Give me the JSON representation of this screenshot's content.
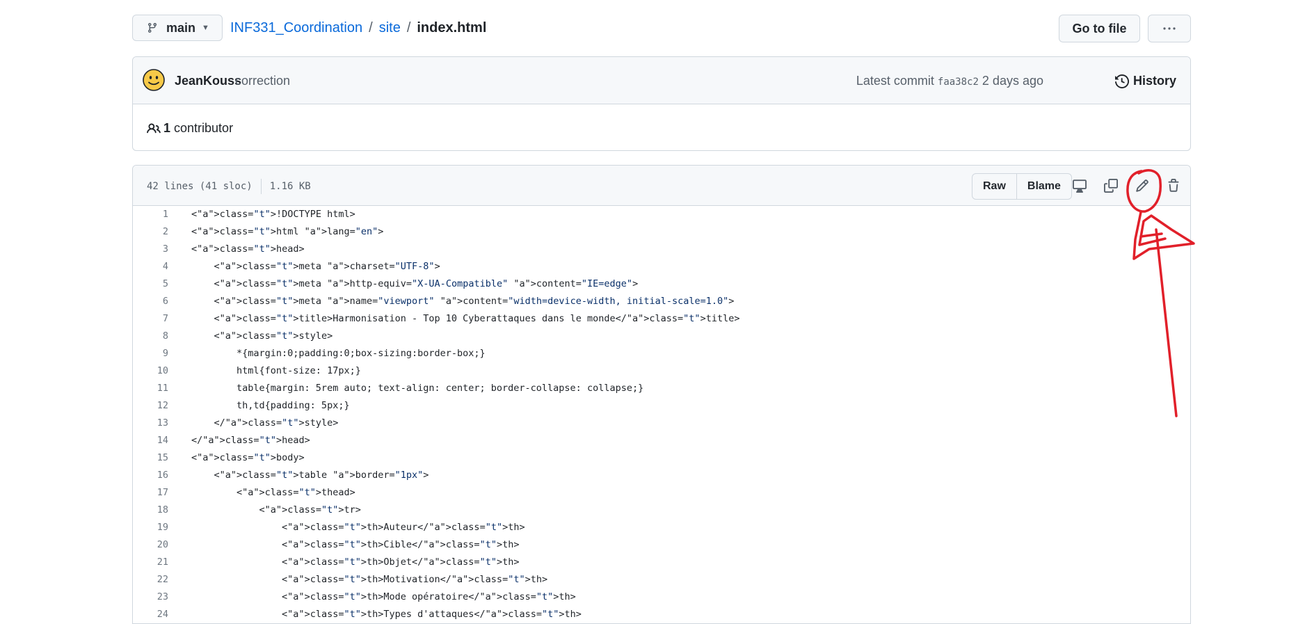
{
  "repo": {
    "branch": "main",
    "breadcrumb": {
      "repo": "INF331_Coordination",
      "folder": "site",
      "sep": "/",
      "file": "index.html"
    },
    "goto_file_label": "Go to file",
    "more_label": "···"
  },
  "commit": {
    "author": "JeanKouss",
    "message": "correction",
    "latest_label": "Latest commit",
    "sha": "faa38c2",
    "age": "2 days ago",
    "history_label": "History"
  },
  "contributors": {
    "count": "1",
    "label": "contributor"
  },
  "file": {
    "lines_info": "42 lines (41 sloc)",
    "size": "1.16 KB",
    "raw_label": "Raw",
    "blame_label": "Blame"
  },
  "code_lines": [
    "<!DOCTYPE html>",
    "<html lang=\"en\">",
    "<head>",
    "    <meta charset=\"UTF-8\">",
    "    <meta http-equiv=\"X-UA-Compatible\" content=\"IE=edge\">",
    "    <meta name=\"viewport\" content=\"width=device-width, initial-scale=1.0\">",
    "    <title>Harmonisation - Top 10 Cyberattaques dans le monde</title>",
    "    <style>",
    "        *{margin:0;padding:0;box-sizing:border-box;}",
    "        html{font-size: 17px;}",
    "        table{margin: 5rem auto; text-align: center; border-collapse: collapse;}",
    "        th,td{padding: 5px;}",
    "    </style>",
    "</head>",
    "<body>",
    "    <table border=\"1px\">",
    "        <thead>",
    "            <tr>",
    "                <th>Auteur</th>",
    "                <th>Cible</th>",
    "                <th>Objet</th>",
    "                <th>Motivation</th>",
    "                <th>Mode opératoire</th>",
    "                <th>Types d'attaques</th>"
  ],
  "colors": {
    "link": "#0969da",
    "annotation": "#e1202a",
    "avatar": "#f7c948"
  },
  "icons": [
    "git-branch-icon",
    "caret-down-icon",
    "kebab-horizontal-icon",
    "smiley-avatar-icon",
    "history-icon",
    "people-icon",
    "desktop-icon",
    "copy-icon",
    "pencil-icon",
    "trash-icon"
  ]
}
